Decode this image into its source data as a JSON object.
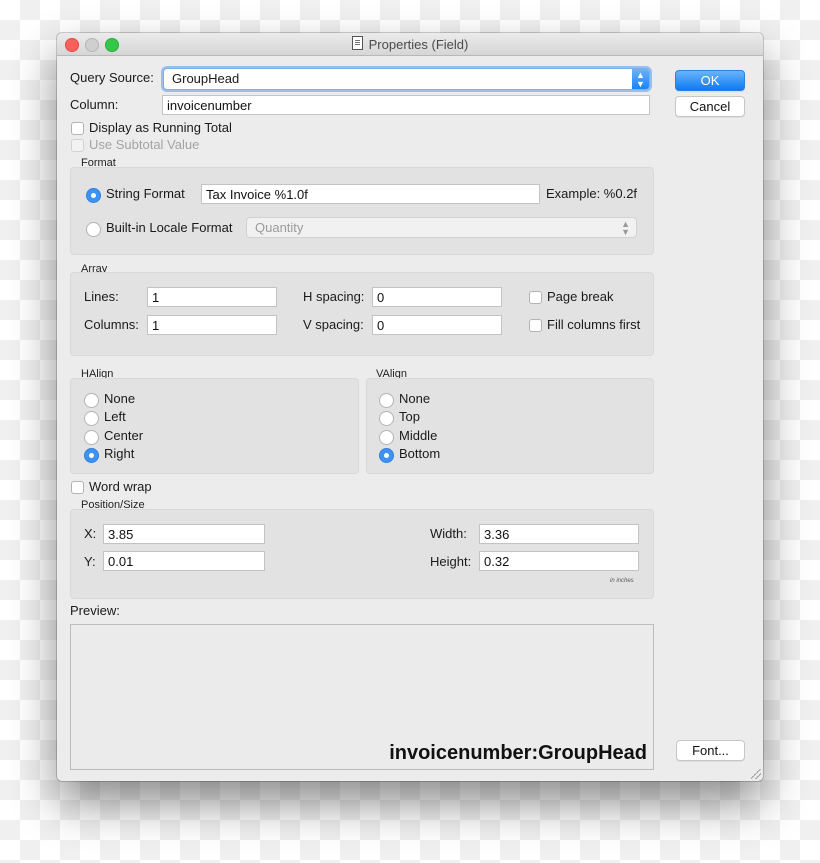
{
  "window": {
    "title": "Properties (Field)",
    "title_icon": "document-icon"
  },
  "query_source": {
    "label": "Query Source:",
    "value": "GroupHead"
  },
  "column": {
    "label": "Column:",
    "value": "invoicenumber"
  },
  "running_total": {
    "label": "Display as Running Total",
    "checked": false
  },
  "subtotal": {
    "label": "Use Subtotal Value",
    "checked": false,
    "disabled": true
  },
  "buttons": {
    "ok": "OK",
    "cancel": "Cancel",
    "font": "Font..."
  },
  "format": {
    "title": "Format",
    "string_format_label": "String Format",
    "string_format_value": "Tax Invoice %1.0f",
    "example": "Example: %0.2f",
    "locale_label": "Built-in Locale Format",
    "locale_value": "Quantity",
    "selected": "String Format"
  },
  "array": {
    "title": "Array",
    "lines_label": "Lines:",
    "lines_value": "1",
    "columns_label": "Columns:",
    "columns_value": "1",
    "hspacing_label": "H spacing:",
    "hspacing_value": "0",
    "vspacing_label": "V spacing:",
    "vspacing_value": "0",
    "page_break_label": "Page break",
    "page_break_checked": false,
    "fill_columns_label": "Fill columns first",
    "fill_columns_checked": false
  },
  "halign": {
    "title": "HAlign",
    "options": [
      "None",
      "Left",
      "Center",
      "Right"
    ],
    "selected": "Right"
  },
  "valign": {
    "title": "VAlign",
    "options": [
      "None",
      "Top",
      "Middle",
      "Bottom"
    ],
    "selected": "Bottom"
  },
  "word_wrap": {
    "label": "Word wrap",
    "checked": false
  },
  "position_size": {
    "title": "Position/Size",
    "x_label": "X:",
    "x_value": "3.85",
    "y_label": "Y:",
    "y_value": "0.01",
    "width_label": "Width:",
    "width_value": "3.36",
    "height_label": "Height:",
    "height_value": "0.32",
    "units": "in inches"
  },
  "preview": {
    "label": "Preview:",
    "text": "invoicenumber:GroupHead"
  },
  "colors": {
    "accent": "#1a82fb",
    "window_bg": "#ececec",
    "group_bg": "#e2e2e2"
  }
}
